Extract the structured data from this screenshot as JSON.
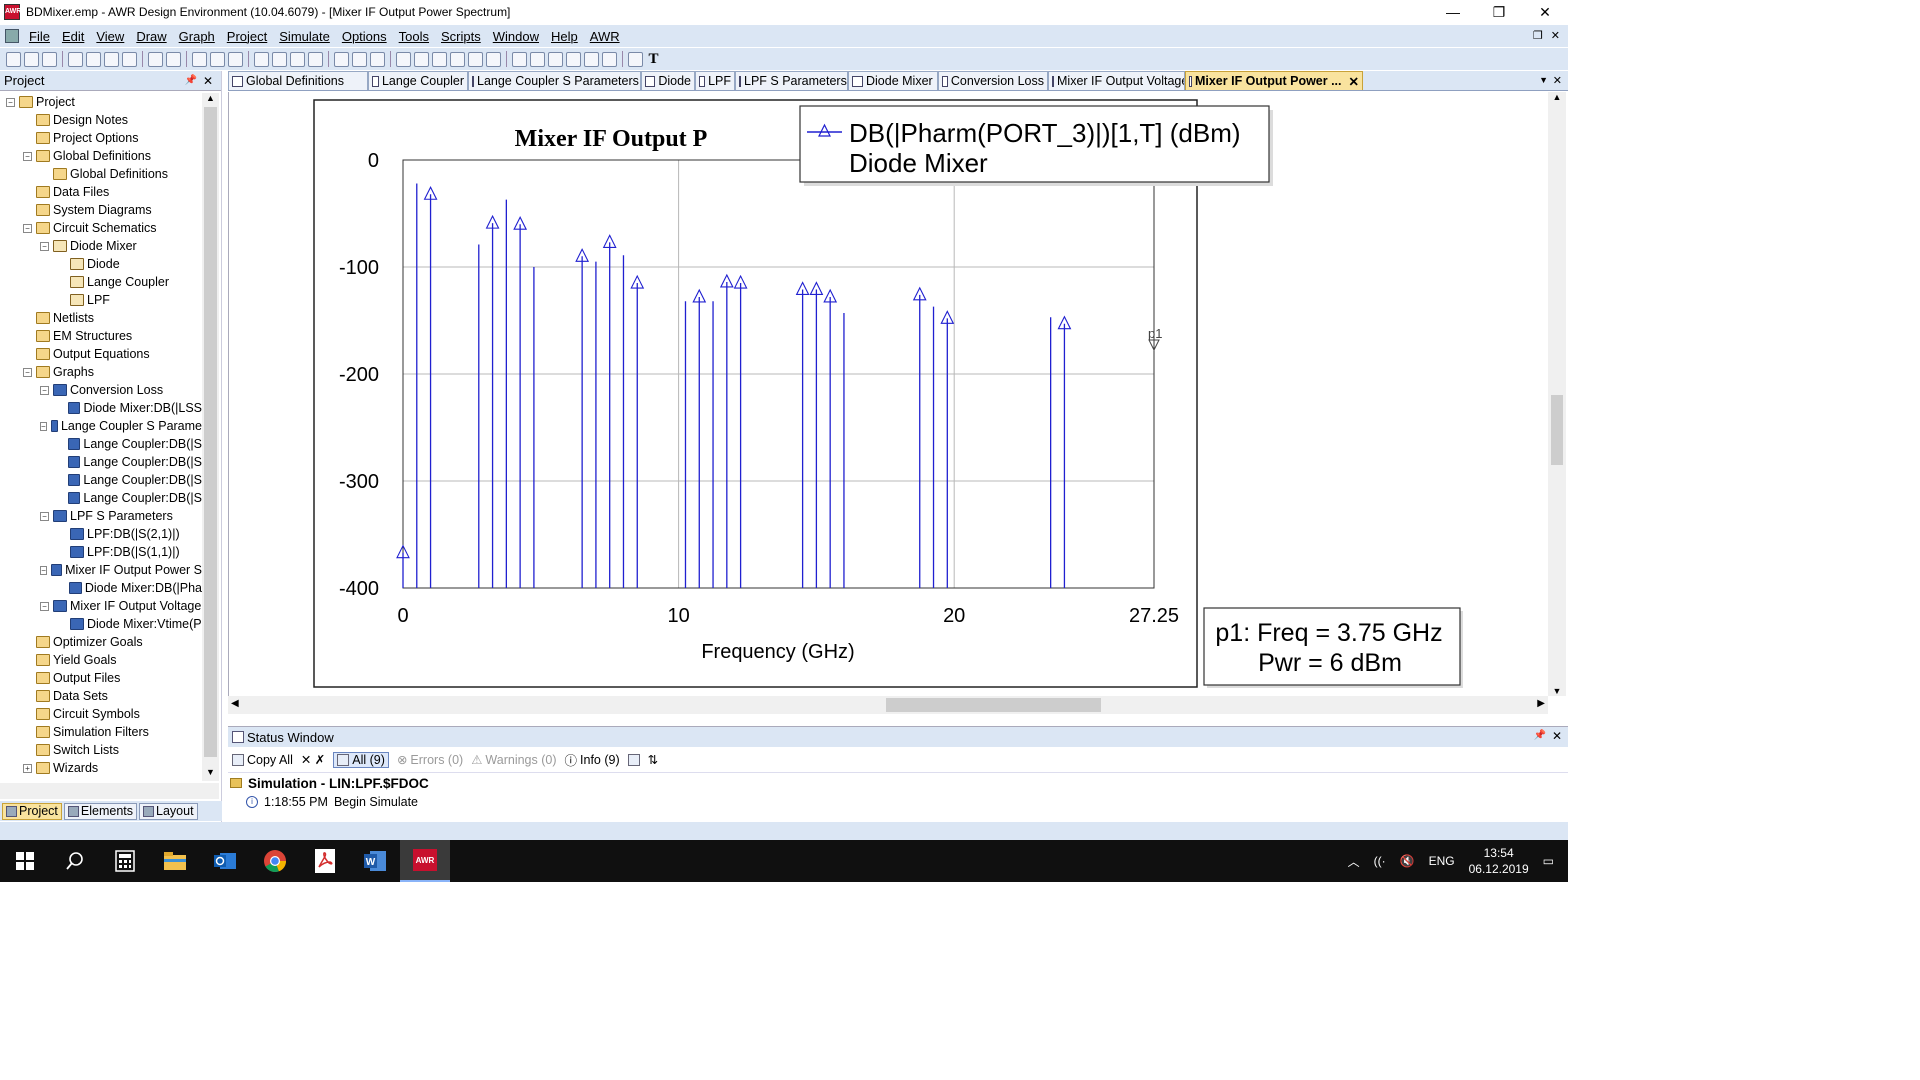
{
  "window": {
    "title": "BDMixer.emp - AWR Design Environment (10.04.6079) - [Mixer IF Output Power Spectrum]",
    "minimize": "—",
    "restore": "❐",
    "close": "✕"
  },
  "menu": {
    "items": [
      "File",
      "Edit",
      "View",
      "Draw",
      "Graph",
      "Project",
      "Simulate",
      "Options",
      "Tools",
      "Scripts",
      "Window",
      "Help",
      "AWR"
    ]
  },
  "project_panel": {
    "title": "Project",
    "tree": [
      {
        "label": "Project",
        "level": 0,
        "exp": "−",
        "icon": "project-icon"
      },
      {
        "label": "Design Notes",
        "level": 1,
        "exp": "",
        "icon": "notes-icon"
      },
      {
        "label": "Project Options",
        "level": 1,
        "exp": "",
        "icon": "options-icon"
      },
      {
        "label": "Global Definitions",
        "level": 1,
        "exp": "−",
        "icon": "folder-icon"
      },
      {
        "label": "Global Definitions",
        "level": 2,
        "exp": "",
        "icon": "global-def-icon"
      },
      {
        "label": "Data Files",
        "level": 1,
        "exp": "",
        "icon": "folder-icon"
      },
      {
        "label": "System Diagrams",
        "level": 1,
        "exp": "",
        "icon": "system-icon"
      },
      {
        "label": "Circuit Schematics",
        "level": 1,
        "exp": "−",
        "icon": "folder-icon"
      },
      {
        "label": "Diode Mixer",
        "level": 2,
        "exp": "−",
        "icon": "schematic-icon"
      },
      {
        "label": "Diode",
        "level": 3,
        "exp": "",
        "icon": "schematic-icon"
      },
      {
        "label": "Lange Coupler",
        "level": 3,
        "exp": "",
        "icon": "schematic-icon"
      },
      {
        "label": "LPF",
        "level": 3,
        "exp": "",
        "icon": "schematic-icon"
      },
      {
        "label": "Netlists",
        "level": 1,
        "exp": "",
        "icon": "folder-icon"
      },
      {
        "label": "EM Structures",
        "level": 1,
        "exp": "",
        "icon": "em-icon"
      },
      {
        "label": "Output Equations",
        "level": 1,
        "exp": "",
        "icon": "equations-icon"
      },
      {
        "label": "Graphs",
        "level": 1,
        "exp": "−",
        "icon": "folder-icon"
      },
      {
        "label": "Conversion Loss",
        "level": 2,
        "exp": "−",
        "icon": "graph-icon"
      },
      {
        "label": "Diode Mixer:DB(|LSS",
        "level": 3,
        "exp": "",
        "icon": "measurement-icon"
      },
      {
        "label": "Lange Coupler S Parame",
        "level": 2,
        "exp": "−",
        "icon": "graph-icon"
      },
      {
        "label": "Lange Coupler:DB(|S",
        "level": 3,
        "exp": "",
        "icon": "measurement-icon"
      },
      {
        "label": "Lange Coupler:DB(|S",
        "level": 3,
        "exp": "",
        "icon": "measurement-icon"
      },
      {
        "label": "Lange Coupler:DB(|S",
        "level": 3,
        "exp": "",
        "icon": "measurement-icon"
      },
      {
        "label": "Lange Coupler:DB(|S",
        "level": 3,
        "exp": "",
        "icon": "measurement-icon"
      },
      {
        "label": "LPF S Parameters",
        "level": 2,
        "exp": "−",
        "icon": "graph-icon"
      },
      {
        "label": "LPF:DB(|S(2,1)|)",
        "level": 3,
        "exp": "",
        "icon": "measurement-icon"
      },
      {
        "label": "LPF:DB(|S(1,1)|)",
        "level": 3,
        "exp": "",
        "icon": "measurement-icon"
      },
      {
        "label": "Mixer IF Output Power S",
        "level": 2,
        "exp": "−",
        "icon": "graph-icon"
      },
      {
        "label": "Diode Mixer:DB(|Pha",
        "level": 3,
        "exp": "",
        "icon": "measurement-icon"
      },
      {
        "label": "Mixer IF Output Voltage",
        "level": 2,
        "exp": "−",
        "icon": "graph-icon"
      },
      {
        "label": "Diode Mixer:Vtime(P",
        "level": 3,
        "exp": "",
        "icon": "measurement-icon"
      },
      {
        "label": "Optimizer Goals",
        "level": 1,
        "exp": "",
        "icon": "goals-icon"
      },
      {
        "label": "Yield Goals",
        "level": 1,
        "exp": "",
        "icon": "goals-icon"
      },
      {
        "label": "Output Files",
        "level": 1,
        "exp": "",
        "icon": "folder-icon"
      },
      {
        "label": "Data Sets",
        "level": 1,
        "exp": "",
        "icon": "datasets-icon"
      },
      {
        "label": "Circuit Symbols",
        "level": 1,
        "exp": "",
        "icon": "symbols-icon"
      },
      {
        "label": "Simulation Filters",
        "level": 1,
        "exp": "",
        "icon": "filters-icon"
      },
      {
        "label": "Switch Lists",
        "level": 1,
        "exp": "",
        "icon": "switch-icon"
      },
      {
        "label": "Wizards",
        "level": 1,
        "exp": "+",
        "icon": "wizards-icon"
      }
    ],
    "bottom_tabs": [
      "Project",
      "Elements",
      "Layout"
    ]
  },
  "doc_tabs": [
    {
      "label": "Global Definitions",
      "w": 140
    },
    {
      "label": "Lange Coupler",
      "w": 100
    },
    {
      "label": "Lange Coupler S Parameters",
      "w": 173
    },
    {
      "label": "Diode",
      "w": 54
    },
    {
      "label": "LPF",
      "w": 40
    },
    {
      "label": "LPF S Parameters",
      "w": 113
    },
    {
      "label": "Diode Mixer",
      "w": 90
    },
    {
      "label": "Conversion Loss",
      "w": 110
    },
    {
      "label": "Mixer IF Output Voltage",
      "w": 137
    },
    {
      "label": "Mixer IF Output Power ...",
      "w": 178,
      "active": true
    }
  ],
  "graph": {
    "title": "Mixer IF Output P",
    "legend": {
      "line1": "DB(|Pharm(PORT_3)|)[1,T] (dBm)",
      "line2": "Diode Mixer"
    },
    "marker_label": "p1",
    "marker_readout": {
      "line1": "p1: Freq = 3.75 GHz",
      "line2": "Pwr = 6 dBm"
    },
    "series_color": "#2020d0"
  },
  "chart_data": {
    "type": "bar",
    "title": "Mixer IF Output P",
    "xlabel": "Frequency (GHz)",
    "ylabel": "",
    "xlim": [
      0,
      27.25
    ],
    "ylim": [
      -400,
      0
    ],
    "xticks": [
      "0",
      "10",
      "20",
      "27.25"
    ],
    "yticks": [
      "0",
      "-100",
      "-200",
      "-300",
      "-400"
    ],
    "grid": true,
    "legend_position": "top-right",
    "series": [
      {
        "name": "DB(|Pharm(PORT_3)|)[1,T] (dBm)",
        "x": [
          0,
          0.5,
          1,
          2.75,
          3.25,
          3.75,
          4.25,
          4.75,
          6.5,
          7,
          7.5,
          8,
          8.5,
          10.25,
          10.75,
          11.25,
          11.75,
          12.25,
          14.5,
          15,
          15.5,
          16,
          18.75,
          19.25,
          19.75,
          23.5,
          24
        ],
        "y": [
          -367,
          -22,
          -32,
          -79,
          -59,
          -37,
          -60,
          -100,
          -90,
          -95,
          -77,
          -89,
          -115,
          -132,
          -128,
          -132,
          -114,
          -115,
          -121,
          -121,
          -128,
          -143,
          -126,
          -137,
          -148,
          -147,
          -153
        ],
        "markers_at": [
          -367,
          -32,
          -59,
          -60,
          -90,
          -77,
          -115,
          -128,
          -114,
          -121,
          -128,
          -126,
          -148,
          -153
        ]
      }
    ]
  },
  "status": {
    "title": "Status Window",
    "toolbar": [
      "Copy All",
      "All (9)",
      "Errors (0)",
      "Warnings (0)",
      "Info (9)"
    ],
    "group": "Simulation  - LIN:LPF.$FDOC",
    "row_time": "1:18:55 PM",
    "row_msg": "Begin Simulate"
  },
  "taskbar": {
    "lang": "ENG",
    "time": "13:54",
    "date": "06.12.2019",
    "apps": [
      "start-icon",
      "search-icon",
      "calculator-icon",
      "file-explorer-icon",
      "outlook-icon",
      "chrome-icon",
      "pdf-icon",
      "word-icon",
      "awr-icon"
    ]
  }
}
